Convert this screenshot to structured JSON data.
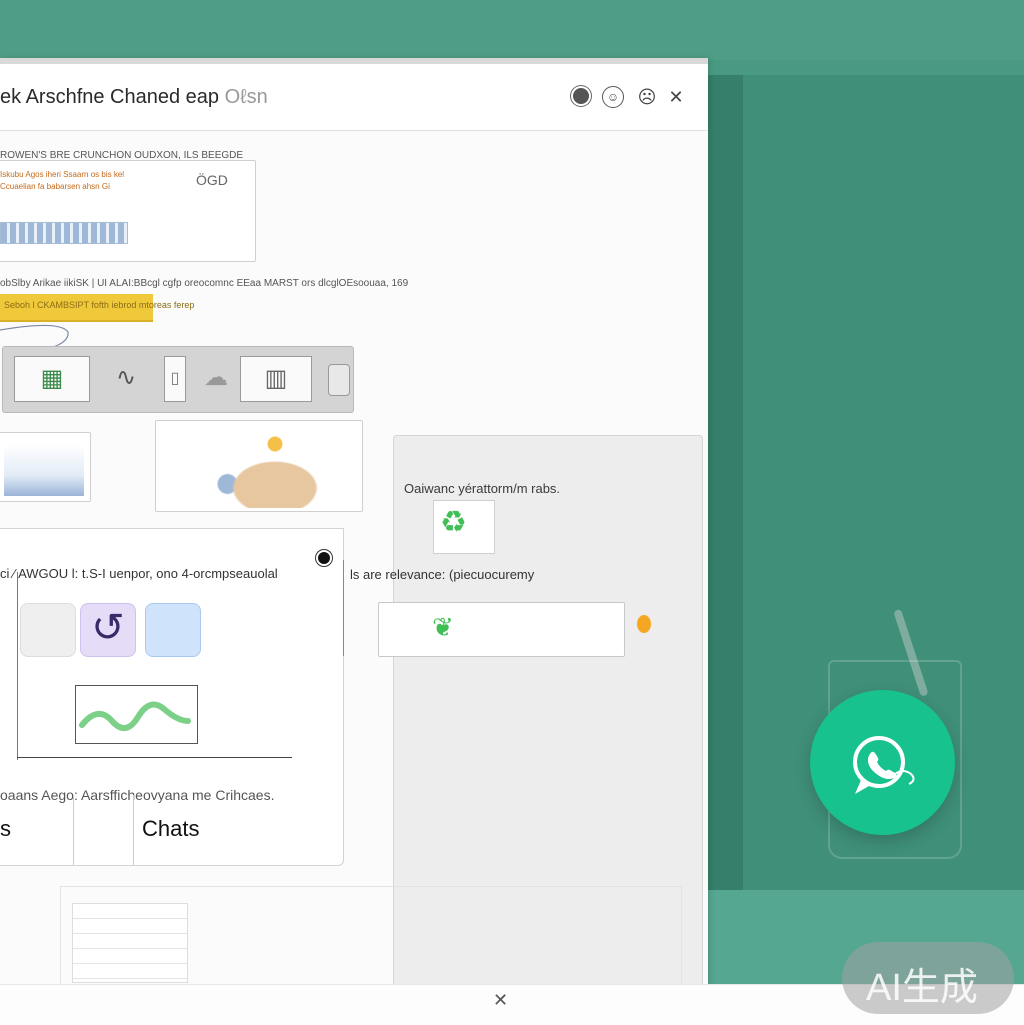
{
  "window": {
    "title": "ek Arschfne Chaned eap",
    "title_suffix": "Oℓsn"
  },
  "cards": {
    "card1_heading": "ROWEN'S BRE CRUNCHON OUDXON, ILS BEEGDE",
    "card1_line1": "Iskubu Agos iheri Ssaarn os bis kel",
    "card1_line2": "Ccuaelian fa babarsen ahsn  Gi",
    "card1_label": "ÖGD",
    "row_text": "obSlby Arikae iikiSK | UI ALAI:BBcgl cgfp oreocomnc EEaa MARST ors dlcglOEsoouaa, 169",
    "yellow_text": "Seboh l CKAMBSIPT fofth iebrod mtoreas ferep"
  },
  "panel_right": {
    "label": "Oaiwanc yérattorm/m rabs."
  },
  "lower": {
    "header": "ci  ⁄ AWGOU l: t.S-I uenpor, ono 4-orcmpseauolal",
    "mid_label": "ls are relevance: (piecuocuremy",
    "caption": "oaans Aego:  Aarsfficheovyana me Crihcaes.",
    "tab_left": "s",
    "tab_chats": "Chats"
  },
  "watermark": "AI生成",
  "colors": {
    "teal_background": "#4a9a83",
    "whatsapp_green": "#18c28e",
    "accent_yellow": "#f0c93b",
    "accent_orange": "#f5a623"
  },
  "icons": {
    "titlebar": [
      "record-icon",
      "smile-icon",
      "face-icon",
      "close-icon"
    ],
    "fab": "whatsapp-icon",
    "bottom": "close-icon"
  }
}
